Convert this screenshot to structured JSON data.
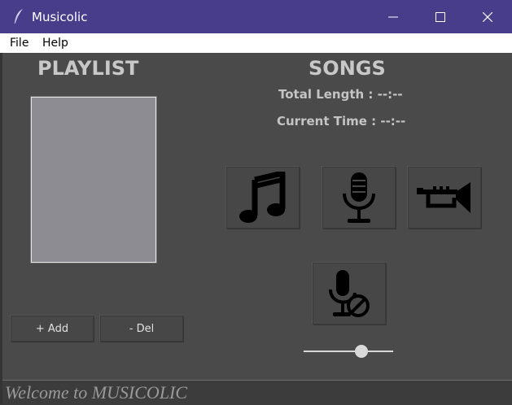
{
  "window": {
    "title": "Musicolic",
    "controls": {
      "minimize": "minimize",
      "maximize": "maximize",
      "close": "close"
    }
  },
  "menu": {
    "file": "File",
    "help": "Help"
  },
  "playlist": {
    "heading": "PLAYLIST",
    "add_label": "+ Add",
    "del_label": "- Del"
  },
  "songs": {
    "heading": "SONGS",
    "total_length": "Total Length : --:--",
    "current_time": "Current Time : --:--"
  },
  "buttons": {
    "row1": [
      "music-note-icon",
      "microphone-icon",
      "trumpet-icon"
    ],
    "row2": [
      "microphone-off-icon"
    ]
  },
  "volume": {
    "level": 0.67
  },
  "status": {
    "text": "Welcome to MUSICOLIC"
  },
  "colors": {
    "titlebar": "#483d8b",
    "background": "#4a4a4a",
    "playlist_box": "#8e8c93",
    "heading_text": "#c8c8c8"
  }
}
